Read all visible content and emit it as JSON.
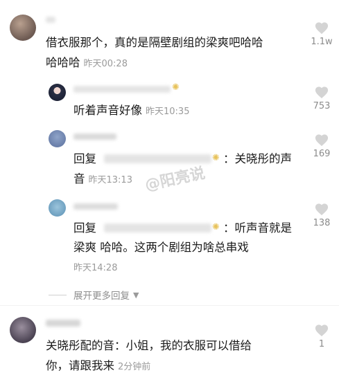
{
  "comments": [
    {
      "text_lines": [
        "借衣服那个，真的是隔壁剧组的梁爽吧哈哈",
        "哈哈哈"
      ],
      "time": "昨天00:28",
      "likes": "1.1w"
    },
    {
      "text": "听着声音好像",
      "time": "昨天10:35",
      "likes": "753"
    },
    {
      "reply_prefix": "回复",
      "text_after": "：关晓彤的声",
      "text_line2": "音",
      "time": "昨天13:13",
      "likes": "169"
    },
    {
      "reply_prefix": "回复",
      "text_after": "：听声音就是",
      "text_line2": "梁爽 哈哈。这两个剧组为啥总串戏",
      "time": "昨天14:28",
      "likes": "138"
    },
    {
      "text_lines": [
        "关晓彤配的音：小姐，我的衣服可以借给",
        "你，请跟我来"
      ],
      "time": "2分钟前",
      "likes": "1"
    }
  ],
  "expand_label": "展开更多回复",
  "watermark": "@阳亮说",
  "icons": {
    "like": "heart-icon",
    "sun": "sun-icon",
    "expand": "chevron-down-icon"
  },
  "colors": {
    "like": "#d4d4d4",
    "muted": "#9a9a9a",
    "text": "#1b1b1b"
  }
}
